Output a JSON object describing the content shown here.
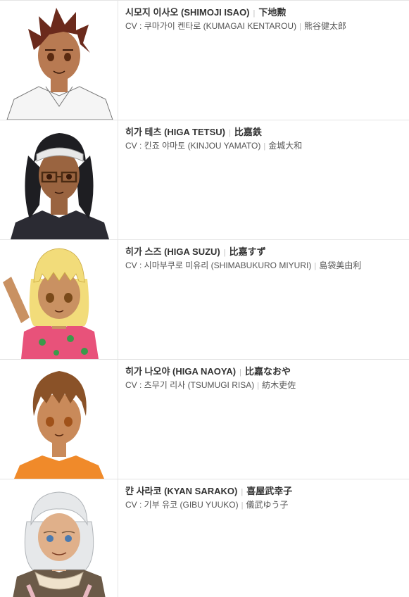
{
  "characters": [
    {
      "korean_name": "시모지 이사오",
      "romaji": "(SHIMOJI ISAO)",
      "kanji": "下地勲",
      "cv_label": "CV : ",
      "cv_korean": "쿠마가이 켄타로",
      "cv_romaji": "(KUMAGAI KENTAROU)",
      "cv_kanji": "熊谷健太郎",
      "hair_color": "#6b2a1c",
      "skin_color": "#b87a52",
      "shirt_color": "#f5f5f5"
    },
    {
      "korean_name": "히가 테츠",
      "romaji": "(HIGA TETSU)",
      "kanji": "比嘉鉄",
      "cv_label": "CV : ",
      "cv_korean": "킨죠 야마토",
      "cv_romaji": "(KINJOU YAMATO)",
      "cv_kanji": "金城大和",
      "hair_color": "#1e1e22",
      "skin_color": "#9a6440",
      "shirt_color": "#2b2b33"
    },
    {
      "korean_name": "히가 스즈",
      "romaji": "(HIGA SUZU)",
      "kanji": "比嘉すず",
      "cv_label": "CV : ",
      "cv_korean": "시마부쿠로 미유리",
      "cv_romaji": "(SHIMABUKURO MIYURI)",
      "cv_kanji": "島袋美由利",
      "hair_color": "#f2dc7a",
      "skin_color": "#c99162",
      "shirt_color": "#e8527a"
    },
    {
      "korean_name": "히가 나오야",
      "romaji": "(HIGA NAOYA)",
      "kanji": "比嘉なおや",
      "cv_label": "CV : ",
      "cv_korean": "츠무기 리사",
      "cv_romaji": "(TSUMUGI RISA)",
      "cv_kanji": "紡木吏佐",
      "hair_color": "#8a5228",
      "skin_color": "#c98a5a",
      "shirt_color": "#f08a2a"
    },
    {
      "korean_name": "캰 사라코",
      "romaji": "(KYAN SARAKO)",
      "kanji": "喜屋武幸子",
      "cv_label": "CV : ",
      "cv_korean": "기부 유코",
      "cv_romaji": "(GIBU YUUKO)",
      "cv_kanji": "儀武ゆう子",
      "hair_color": "#e6e8ea",
      "skin_color": "#e0b08a",
      "shirt_color": "#6b5a48"
    }
  ],
  "separator": "|"
}
